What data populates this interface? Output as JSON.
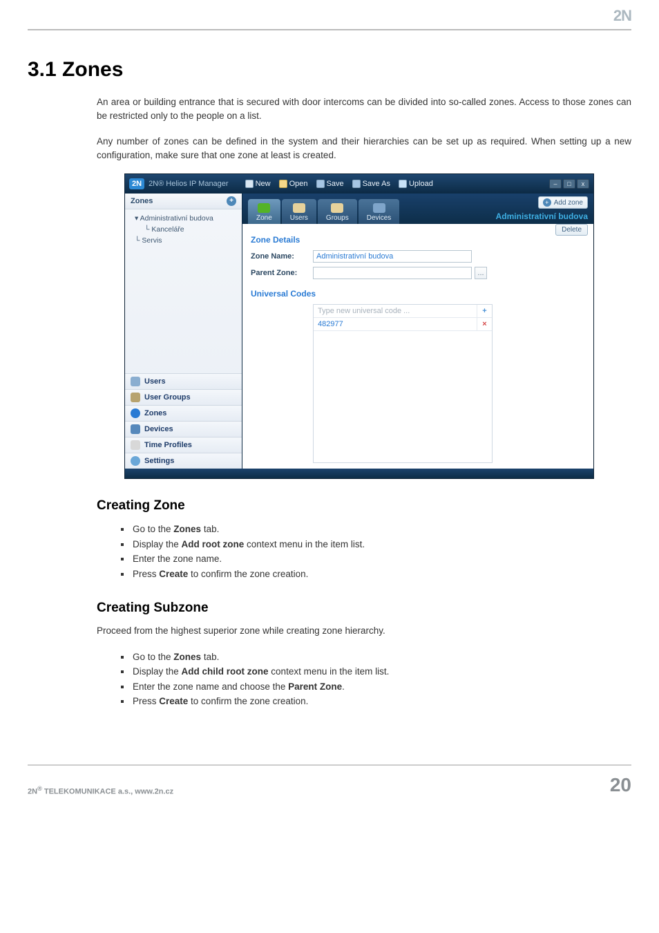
{
  "page": {
    "brand": "2N",
    "heading": "3.1 Zones",
    "paragraph1": "An area or building entrance that is secured with door intercoms can be divided into so-called zones. Access to those zones can be restricted only to the people on a list.",
    "paragraph2": "Any number of zones can be defined in the system and their hierarchies can be set up as required. When setting up a new configuration, make sure that one zone at least is created.",
    "sub1": "Creating Zone",
    "sub1_items": {
      "a_pre": "Go to the ",
      "a_b": "Zones",
      "a_post": " tab.",
      "b_pre": "Display the ",
      "b_b": "Add root zone",
      "b_post": " context menu in the item list.",
      "c": "Enter the zone name.",
      "d_pre": "Press ",
      "d_b": "Create",
      "d_post": " to confirm the zone creation."
    },
    "sub2": "Creating Subzone",
    "sub2_lead": "Proceed from the highest superior zone while creating zone hierarchy.",
    "sub2_items": {
      "a_pre": "Go to the ",
      "a_b": "Zones",
      "a_post": " tab.",
      "b_pre": "Display the ",
      "b_b": "Add child root zone",
      "b_post": " context menu in the item list.",
      "c_pre": "Enter the zone name and choose the ",
      "c_b": "Parent Zone",
      "c_post": ".",
      "d_pre": "Press ",
      "d_b": "Create",
      "d_post": " to confirm the zone creation."
    },
    "footer_left_pre": "2N",
    "footer_left_post": " TELEKOMUNIKACE a.s., www.2n.cz",
    "footer_right": "20"
  },
  "app": {
    "title_brand": "2N",
    "title_text": "2N® Helios IP Manager",
    "toolbar": {
      "new": "New",
      "open": "Open",
      "save": "Save",
      "saveas": "Save As",
      "upload": "Upload"
    },
    "win": {
      "min": "–",
      "max": "□",
      "close": "x"
    },
    "sidebar": {
      "section_title": "Zones",
      "tree": {
        "root": "Administrativní budova",
        "child1": "Kanceláře",
        "child2": "Servis"
      },
      "nav": {
        "users": "Users",
        "groups": "User Groups",
        "zones": "Zones",
        "devices": "Devices",
        "time": "Time Profiles",
        "settings": "Settings"
      }
    },
    "tabs": {
      "zone": "Zone",
      "users": "Users",
      "groups": "Groups",
      "devices": "Devices"
    },
    "right": {
      "add_zone": "Add zone",
      "title": "Administrativní budova",
      "delete": "Delete"
    },
    "details": {
      "title": "Zone Details",
      "name_label": "Zone Name:",
      "name_value": "Administrativní budova",
      "parent_label": "Parent Zone:",
      "parent_value": "",
      "picker_glyph": "..."
    },
    "codes": {
      "title": "Universal Codes",
      "placeholder": "Type new universal code ...",
      "value": "482977",
      "add_glyph": "+",
      "remove_glyph": "×"
    }
  }
}
